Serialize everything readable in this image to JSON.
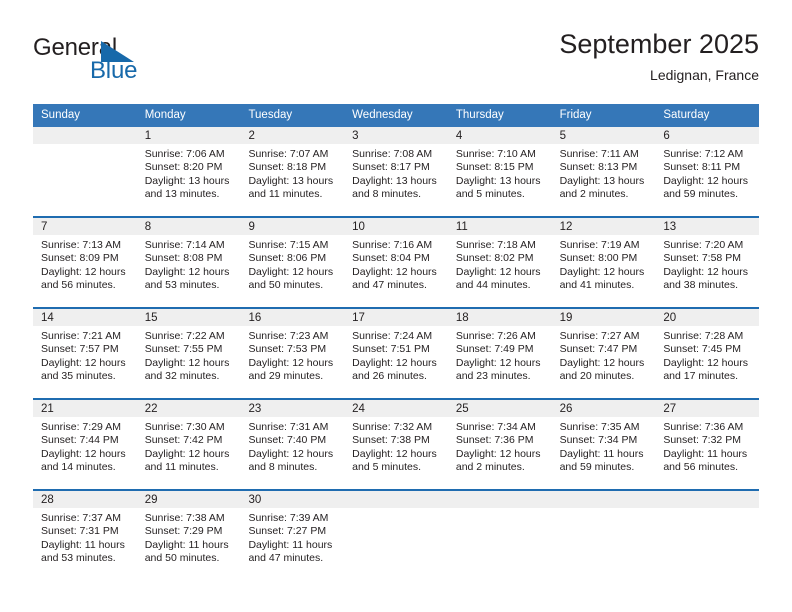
{
  "brand": {
    "name_part1": "General",
    "name_part2": "Blue",
    "flag_icon": "blue-flag-triangle-icon",
    "accent_color": "#1769aa"
  },
  "header": {
    "title": "September 2025",
    "subtitle": "Ledignan, France"
  },
  "theme": {
    "header_blue": "#3577b8",
    "row_divider_blue": "#1f6cb0",
    "date_band_gray": "#efefef"
  },
  "weekdays": [
    "Sunday",
    "Monday",
    "Tuesday",
    "Wednesday",
    "Thursday",
    "Friday",
    "Saturday"
  ],
  "weeks": [
    [
      {
        "day": "",
        "empty": true,
        "sunrise": "",
        "sunset": "",
        "daylight_line1": "",
        "daylight_line2": ""
      },
      {
        "day": "1",
        "sunrise": "Sunrise: 7:06 AM",
        "sunset": "Sunset: 8:20 PM",
        "daylight_line1": "Daylight: 13 hours",
        "daylight_line2": "and 13 minutes."
      },
      {
        "day": "2",
        "sunrise": "Sunrise: 7:07 AM",
        "sunset": "Sunset: 8:18 PM",
        "daylight_line1": "Daylight: 13 hours",
        "daylight_line2": "and 11 minutes."
      },
      {
        "day": "3",
        "sunrise": "Sunrise: 7:08 AM",
        "sunset": "Sunset: 8:17 PM",
        "daylight_line1": "Daylight: 13 hours",
        "daylight_line2": "and 8 minutes."
      },
      {
        "day": "4",
        "sunrise": "Sunrise: 7:10 AM",
        "sunset": "Sunset: 8:15 PM",
        "daylight_line1": "Daylight: 13 hours",
        "daylight_line2": "and 5 minutes."
      },
      {
        "day": "5",
        "sunrise": "Sunrise: 7:11 AM",
        "sunset": "Sunset: 8:13 PM",
        "daylight_line1": "Daylight: 13 hours",
        "daylight_line2": "and 2 minutes."
      },
      {
        "day": "6",
        "sunrise": "Sunrise: 7:12 AM",
        "sunset": "Sunset: 8:11 PM",
        "daylight_line1": "Daylight: 12 hours",
        "daylight_line2": "and 59 minutes."
      }
    ],
    [
      {
        "day": "7",
        "sunrise": "Sunrise: 7:13 AM",
        "sunset": "Sunset: 8:09 PM",
        "daylight_line1": "Daylight: 12 hours",
        "daylight_line2": "and 56 minutes."
      },
      {
        "day": "8",
        "sunrise": "Sunrise: 7:14 AM",
        "sunset": "Sunset: 8:08 PM",
        "daylight_line1": "Daylight: 12 hours",
        "daylight_line2": "and 53 minutes."
      },
      {
        "day": "9",
        "sunrise": "Sunrise: 7:15 AM",
        "sunset": "Sunset: 8:06 PM",
        "daylight_line1": "Daylight: 12 hours",
        "daylight_line2": "and 50 minutes."
      },
      {
        "day": "10",
        "sunrise": "Sunrise: 7:16 AM",
        "sunset": "Sunset: 8:04 PM",
        "daylight_line1": "Daylight: 12 hours",
        "daylight_line2": "and 47 minutes."
      },
      {
        "day": "11",
        "sunrise": "Sunrise: 7:18 AM",
        "sunset": "Sunset: 8:02 PM",
        "daylight_line1": "Daylight: 12 hours",
        "daylight_line2": "and 44 minutes."
      },
      {
        "day": "12",
        "sunrise": "Sunrise: 7:19 AM",
        "sunset": "Sunset: 8:00 PM",
        "daylight_line1": "Daylight: 12 hours",
        "daylight_line2": "and 41 minutes."
      },
      {
        "day": "13",
        "sunrise": "Sunrise: 7:20 AM",
        "sunset": "Sunset: 7:58 PM",
        "daylight_line1": "Daylight: 12 hours",
        "daylight_line2": "and 38 minutes."
      }
    ],
    [
      {
        "day": "14",
        "sunrise": "Sunrise: 7:21 AM",
        "sunset": "Sunset: 7:57 PM",
        "daylight_line1": "Daylight: 12 hours",
        "daylight_line2": "and 35 minutes."
      },
      {
        "day": "15",
        "sunrise": "Sunrise: 7:22 AM",
        "sunset": "Sunset: 7:55 PM",
        "daylight_line1": "Daylight: 12 hours",
        "daylight_line2": "and 32 minutes."
      },
      {
        "day": "16",
        "sunrise": "Sunrise: 7:23 AM",
        "sunset": "Sunset: 7:53 PM",
        "daylight_line1": "Daylight: 12 hours",
        "daylight_line2": "and 29 minutes."
      },
      {
        "day": "17",
        "sunrise": "Sunrise: 7:24 AM",
        "sunset": "Sunset: 7:51 PM",
        "daylight_line1": "Daylight: 12 hours",
        "daylight_line2": "and 26 minutes."
      },
      {
        "day": "18",
        "sunrise": "Sunrise: 7:26 AM",
        "sunset": "Sunset: 7:49 PM",
        "daylight_line1": "Daylight: 12 hours",
        "daylight_line2": "and 23 minutes."
      },
      {
        "day": "19",
        "sunrise": "Sunrise: 7:27 AM",
        "sunset": "Sunset: 7:47 PM",
        "daylight_line1": "Daylight: 12 hours",
        "daylight_line2": "and 20 minutes."
      },
      {
        "day": "20",
        "sunrise": "Sunrise: 7:28 AM",
        "sunset": "Sunset: 7:45 PM",
        "daylight_line1": "Daylight: 12 hours",
        "daylight_line2": "and 17 minutes."
      }
    ],
    [
      {
        "day": "21",
        "sunrise": "Sunrise: 7:29 AM",
        "sunset": "Sunset: 7:44 PM",
        "daylight_line1": "Daylight: 12 hours",
        "daylight_line2": "and 14 minutes."
      },
      {
        "day": "22",
        "sunrise": "Sunrise: 7:30 AM",
        "sunset": "Sunset: 7:42 PM",
        "daylight_line1": "Daylight: 12 hours",
        "daylight_line2": "and 11 minutes."
      },
      {
        "day": "23",
        "sunrise": "Sunrise: 7:31 AM",
        "sunset": "Sunset: 7:40 PM",
        "daylight_line1": "Daylight: 12 hours",
        "daylight_line2": "and 8 minutes."
      },
      {
        "day": "24",
        "sunrise": "Sunrise: 7:32 AM",
        "sunset": "Sunset: 7:38 PM",
        "daylight_line1": "Daylight: 12 hours",
        "daylight_line2": "and 5 minutes."
      },
      {
        "day": "25",
        "sunrise": "Sunrise: 7:34 AM",
        "sunset": "Sunset: 7:36 PM",
        "daylight_line1": "Daylight: 12 hours",
        "daylight_line2": "and 2 minutes."
      },
      {
        "day": "26",
        "sunrise": "Sunrise: 7:35 AM",
        "sunset": "Sunset: 7:34 PM",
        "daylight_line1": "Daylight: 11 hours",
        "daylight_line2": "and 59 minutes."
      },
      {
        "day": "27",
        "sunrise": "Sunrise: 7:36 AM",
        "sunset": "Sunset: 7:32 PM",
        "daylight_line1": "Daylight: 11 hours",
        "daylight_line2": "and 56 minutes."
      }
    ],
    [
      {
        "day": "28",
        "sunrise": "Sunrise: 7:37 AM",
        "sunset": "Sunset: 7:31 PM",
        "daylight_line1": "Daylight: 11 hours",
        "daylight_line2": "and 53 minutes."
      },
      {
        "day": "29",
        "sunrise": "Sunrise: 7:38 AM",
        "sunset": "Sunset: 7:29 PM",
        "daylight_line1": "Daylight: 11 hours",
        "daylight_line2": "and 50 minutes."
      },
      {
        "day": "30",
        "sunrise": "Sunrise: 7:39 AM",
        "sunset": "Sunset: 7:27 PM",
        "daylight_line1": "Daylight: 11 hours",
        "daylight_line2": "and 47 minutes."
      },
      {
        "day": "",
        "empty": true,
        "sunrise": "",
        "sunset": "",
        "daylight_line1": "",
        "daylight_line2": ""
      },
      {
        "day": "",
        "empty": true,
        "sunrise": "",
        "sunset": "",
        "daylight_line1": "",
        "daylight_line2": ""
      },
      {
        "day": "",
        "empty": true,
        "sunrise": "",
        "sunset": "",
        "daylight_line1": "",
        "daylight_line2": ""
      },
      {
        "day": "",
        "empty": true,
        "sunrise": "",
        "sunset": "",
        "daylight_line1": "",
        "daylight_line2": ""
      }
    ]
  ]
}
